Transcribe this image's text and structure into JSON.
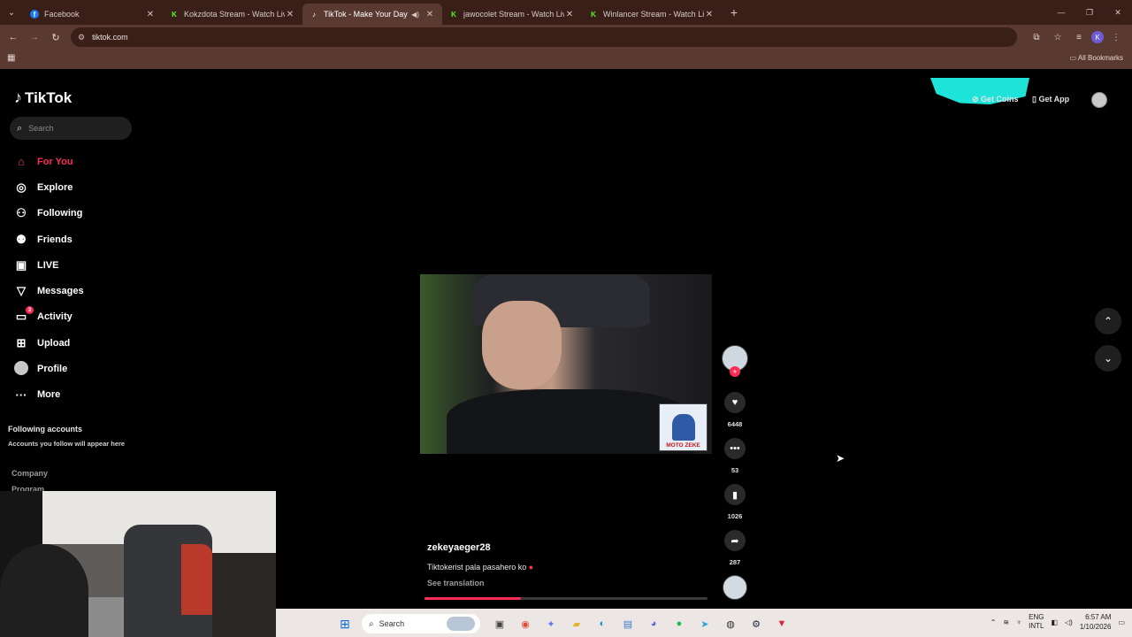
{
  "browser": {
    "tabs": [
      {
        "title": "Facebook",
        "favicon": "f",
        "favicon_color": "#1877f2",
        "active": false
      },
      {
        "title": "Kokzdota Stream - Watch Live",
        "favicon": "K",
        "favicon_color": "#53fc18",
        "active": false
      },
      {
        "title": "TikTok - Make Your Day",
        "favicon": "♪",
        "favicon_color": "#000000",
        "active": true
      },
      {
        "title": "jawocolet Stream - Watch Live",
        "favicon": "K",
        "favicon_color": "#53fc18",
        "active": false
      },
      {
        "title": "Winlancer Stream - Watch Live",
        "favicon": "K",
        "favicon_color": "#53fc18",
        "active": false
      }
    ],
    "url": "tiktok.com",
    "profile_initial": "K",
    "all_bookmarks": "All Bookmarks"
  },
  "sidebar": {
    "logo": "TikTok",
    "search_placeholder": "Search",
    "nav": [
      {
        "label": "For You",
        "icon": "home-icon",
        "active": true
      },
      {
        "label": "Explore",
        "icon": "compass-icon",
        "active": false
      },
      {
        "label": "Following",
        "icon": "user-plus-icon",
        "active": false
      },
      {
        "label": "Friends",
        "icon": "users-icon",
        "active": false
      },
      {
        "label": "LIVE",
        "icon": "live-icon",
        "active": false
      },
      {
        "label": "Messages",
        "icon": "send-icon",
        "active": false
      },
      {
        "label": "Activity",
        "icon": "inbox-icon",
        "active": false,
        "badge": "3"
      },
      {
        "label": "Upload",
        "icon": "plus-square-icon",
        "active": false
      },
      {
        "label": "Profile",
        "icon": "profile-avatar-icon",
        "active": false
      },
      {
        "label": "More",
        "icon": "ellipsis-icon",
        "active": false
      }
    ],
    "following_accounts_title": "Following accounts",
    "following_accounts_sub": "Accounts you follow will appear here",
    "company": "Company",
    "program": "Program"
  },
  "topbar": {
    "get_coins": "Get Coins",
    "get_app": "Get App"
  },
  "video": {
    "watermark": "MOTO ZEKE",
    "username": "zekeyaeger28",
    "caption": "Tiktokerist pala pasahero ko",
    "see_translation": "See translation",
    "progress": 0.34,
    "likes": "6448",
    "comments": "53",
    "saves": "1026",
    "shares": "287"
  },
  "taskbar": {
    "search_label": "Search",
    "lang_line1": "ENG",
    "lang_line2": "INTL",
    "time": "6:57 AM",
    "date": "1/10/2026"
  },
  "colors": {
    "accent": "#fe2c55",
    "chrome_dark": "#3a1f18",
    "chrome_light": "#5a3a30",
    "coins_teal": "#1de3d8"
  }
}
